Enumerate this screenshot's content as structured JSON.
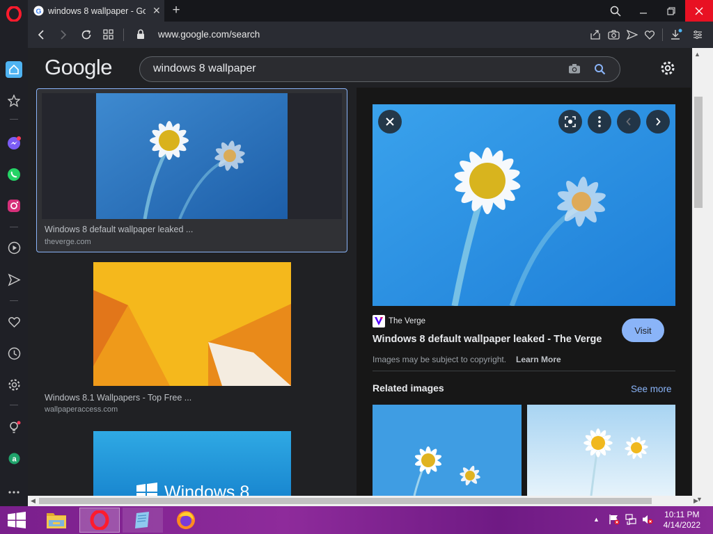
{
  "browser": {
    "tab_title": "windows 8 wallpaper - Goo",
    "url": "www.google.com/search"
  },
  "google": {
    "logo": "Google",
    "search_query": "windows 8 wallpaper"
  },
  "results": [
    {
      "title": "Windows 8 default wallpaper leaked ...",
      "source": "theverge.com"
    },
    {
      "title": "Windows 8.1 Wallpapers - Top Free ...",
      "source": "wallpaperaccess.com"
    },
    {
      "title": "",
      "source": "",
      "image_text": "Windows 8"
    }
  ],
  "preview": {
    "source_name": "The Verge",
    "title": "Windows 8 default wallpaper leaked - The Verge",
    "visit_label": "Visit",
    "copyright_text": "Images may be subject to copyright.",
    "learn_more": "Learn More",
    "related_heading": "Related images",
    "see_more": "See more"
  },
  "taskbar": {
    "time": "10:11 PM",
    "date": "4/14/2022"
  },
  "colors": {
    "accent_blue": "#8ab4f8",
    "opera_red": "#ff1b2d",
    "close_red": "#e81123",
    "taskbar_purple": "#7a1f8c"
  }
}
